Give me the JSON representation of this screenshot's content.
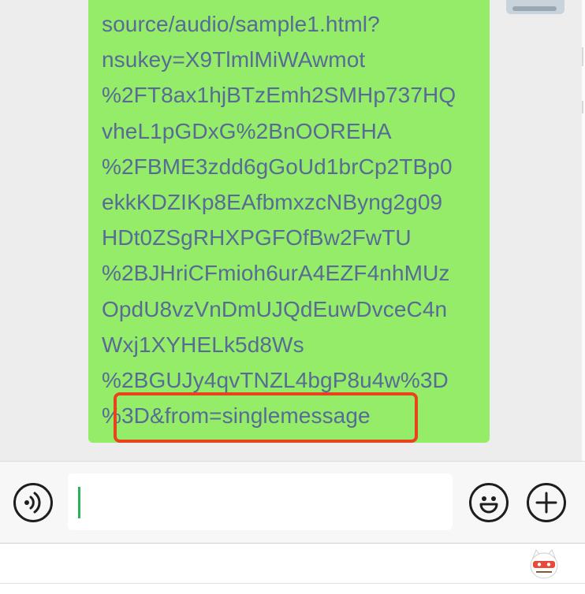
{
  "message": {
    "url_lines": [
      "source/audio/sample1.html?",
      "nsukey=X9TlmlMiWAwmot",
      "%2FT8ax1hjBTzEmh2SMHp737HQ",
      "vheL1pGDxG%2BnOOREHA",
      "%2FBME3zdd6gGoUd1brCp2TBp0",
      "ekkKDZIKp8EAfbmxzcNByng2g09",
      "HDt0ZSgRHXPGFOfBw2FwTU",
      "%2BJHriCFmioh6urA4EZF4nhMUz",
      "OpdU8vzVnDmUJQdEuwDvceC4n",
      "Wxj1XYHELk5d8Ws",
      "%2BGUJy4qvTNZL4bgP8u4w%3D",
      "%3D&from=singlemessage"
    ],
    "bubble_color": "#95ec69",
    "link_color": "#576b95",
    "highlight_color": "#e8431c"
  },
  "input_bar": {
    "voice_icon": "voice-icon",
    "input_value": "",
    "emoji_icon": "emoji-icon",
    "plus_icon": "plus-icon",
    "caret_color": "#2bb358"
  }
}
